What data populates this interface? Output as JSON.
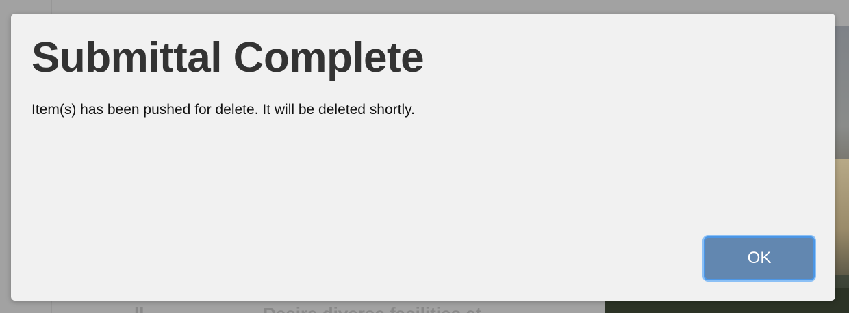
{
  "dialog": {
    "title": "Submittal Complete",
    "message": "Item(s) has been pushed for delete. It will be deleted shortly.",
    "ok_label": "OK"
  },
  "background": {
    "fragment_a": "ll",
    "fragment_b": "Desire diverse facilities at"
  },
  "colors": {
    "overlay": "#a2a2a2",
    "dialog_bg": "#f1f1f1",
    "title_text": "#333333",
    "button_bg": "#6287b0",
    "button_focus_ring": "#4b96e6"
  }
}
